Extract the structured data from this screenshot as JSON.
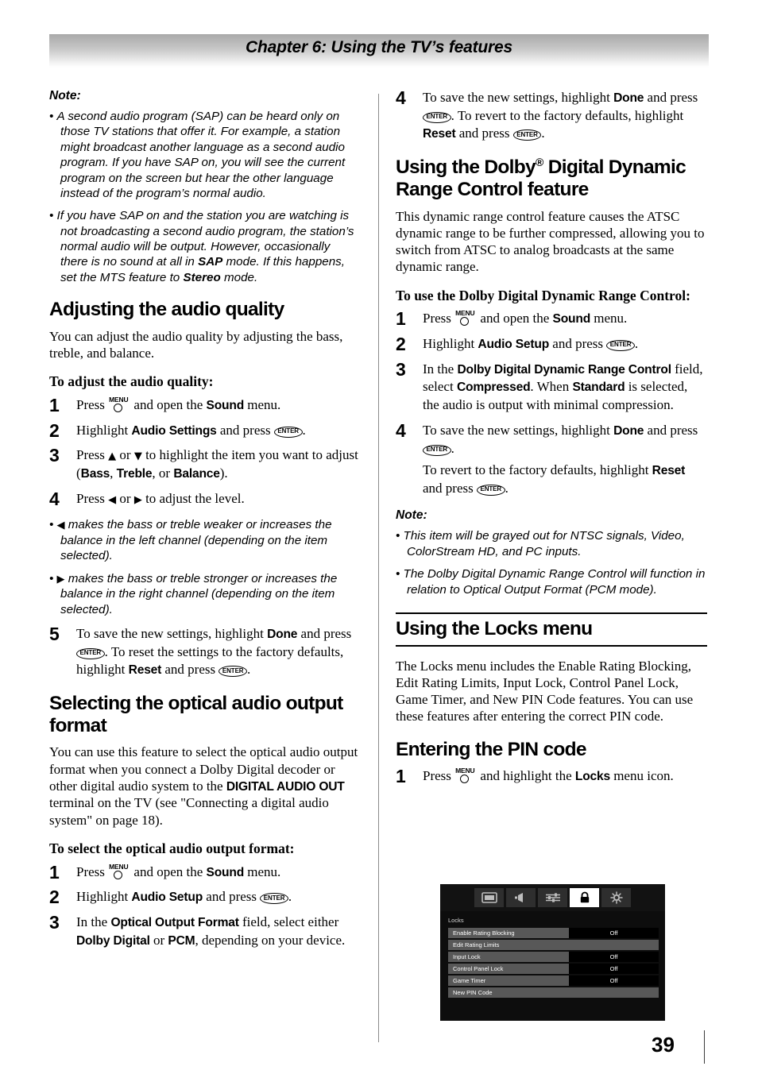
{
  "header": {
    "chapter_title": "Chapter 6: Using the TV’s features"
  },
  "footer": {
    "page_number": "39"
  },
  "left_column": {
    "note": {
      "label": "Note:",
      "items": [
        "A second audio program (SAP) can be heard only on those TV stations that offer it. For example, a station might broadcast another language as a second audio program. If you have SAP on, you will see the current program on the screen but hear the other language instead of the program’s normal audio.",
        {
          "lead": "If you have SAP on and the station you are watching is not broadcasting a second audio program, the station’s normal audio will be output. However, occasionally there is no sound at all in ",
          "bold1": "SAP",
          "mid": " mode. If this happens, set the MTS feature to ",
          "bold2": "Stereo",
          "tail": " mode."
        }
      ]
    },
    "section_audio_quality": {
      "heading": "Adjusting the audio quality",
      "intro": "You can adjust the audio quality by adjusting the bass, treble, and balance.",
      "subheading": "To adjust the audio quality:",
      "steps": [
        {
          "num": "1",
          "pre": "Press ",
          "icon": "menu-button-icon",
          "mid": " and open the ",
          "bold": "Sound",
          "post": " menu."
        },
        {
          "num": "2",
          "pre": "Highlight ",
          "bold": "Audio Settings",
          "mid": " and press ",
          "icon": "enter-button-icon",
          "post": "."
        },
        {
          "num": "3",
          "pre": "Press ",
          "arrow_up": "▲",
          "mid": " or ",
          "arrow_down": "▼",
          "post": " to highlight the item you want to adjust (",
          "bold1": "Bass",
          "sep1": ", ",
          "bold2": "Treble",
          "sep2": ", or ",
          "bold3": "Balance",
          "tail": ")."
        },
        {
          "num": "4",
          "pre": "Press ",
          "arrow_left": "◀",
          "mid": " or ",
          "arrow_right": "▶",
          "post": " to adjust the level."
        }
      ],
      "arrow_notes": [
        {
          "glyph": "◀",
          "text": " makes the bass or treble weaker or increases the balance in the left channel (depending on the item selected)."
        },
        {
          "glyph": "▶",
          "text": " makes the bass or treble stronger or increases the balance in the right channel (depending on the item selected)."
        }
      ],
      "step5": {
        "num": "5",
        "p1_pre": "To save the new settings, highlight ",
        "p1_bold": "Done",
        "p1_mid": " and press ",
        "p1_icon": "enter-button-icon",
        "p1_post": ". To reset the settings to the factory defaults, highlight ",
        "p1_bold2": "Reset",
        "p1_mid2": " and press ",
        "p1_icon2": "enter-button-icon",
        "p1_end": "."
      }
    },
    "section_optical_output": {
      "heading": "Selecting the optical audio output format",
      "intro_pre": "You can use this feature to select the optical audio output format when you connect a Dolby Digital decoder or other digital audio system to the ",
      "intro_bold": "DIGITAL AUDIO OUT",
      "intro_post": " terminal on the TV (see \"Connecting a digital audio system\" on page 18).",
      "subheading": "To select the optical audio output format:",
      "steps": [
        {
          "num": "1",
          "pre": "Press ",
          "icon": "menu-button-icon",
          "mid": " and open the ",
          "bold": "Sound",
          "post": " menu."
        },
        {
          "num": "2",
          "pre": "Highlight ",
          "bold": "Audio Setup",
          "mid": " and press ",
          "icon": "enter-button-icon",
          "post": "."
        },
        {
          "num": "3",
          "pre": "In the ",
          "bold": "Optical Output Format",
          "mid": " field, select either ",
          "bold2": "Dolby Digital",
          "mid2": " or ",
          "bold3": "PCM",
          "post": ", depending on your device."
        }
      ]
    }
  },
  "right_column": {
    "step4_top": {
      "num": "4",
      "pre": "To save the new settings, highlight ",
      "bold": "Done",
      "mid": " and press ",
      "icon": "enter-button-icon",
      "post": ". To revert to the factory defaults, highlight ",
      "bold2": "Reset",
      "mid2": " and press ",
      "icon2": "enter-button-icon",
      "end": "."
    },
    "section_drc": {
      "heading_part1": "Using the Dolby",
      "heading_sup": "®",
      "heading_part2": " Digital Dynamic Range Control feature",
      "intro": "This dynamic range control feature causes the ATSC dynamic range to be further compressed, allowing you to switch from ATSC to analog broadcasts at the same dynamic range.",
      "subheading": "To use the Dolby Digital Dynamic Range Control:",
      "steps": [
        {
          "num": "1",
          "pre": "Press ",
          "icon": "menu-button-icon",
          "mid": " and open the ",
          "bold": "Sound",
          "post": " menu."
        },
        {
          "num": "2",
          "pre": "Highlight ",
          "bold": "Audio Setup",
          "mid": " and press ",
          "icon": "enter-button-icon",
          "post": "."
        },
        {
          "num": "3",
          "pre": "In the ",
          "bold": "Dolby Digital Dynamic Range Control",
          "mid": " field, select ",
          "bold2": "Compressed",
          "mid2": ". When ",
          "bold3": "Standard",
          "post": " is selected, the audio is output with minimal compression."
        }
      ],
      "step4": {
        "num": "4",
        "p1_pre": "To save the new settings, highlight ",
        "p1_bold": "Done",
        "p1_mid": " and press ",
        "p1_icon": "enter-button-icon",
        "p1_end": ".",
        "p2_pre": "To revert to the factory defaults, highlight ",
        "p2_bold": "Reset",
        "p2_mid": " and press ",
        "p2_icon": "enter-button-icon",
        "p2_end": "."
      },
      "note": {
        "label": "Note:",
        "items": [
          "This item will be grayed out for NTSC signals, Video, ColorStream HD, and PC inputs.",
          "The Dolby Digital Dynamic Range Control will function in relation to Optical Output Format (PCM mode)."
        ]
      }
    },
    "section_locks": {
      "heading": "Using the Locks menu",
      "intro": "The Locks menu includes the Enable Rating Blocking, Edit Rating Limits, Input Lock, Control Panel Lock, Game Timer, and New PIN Code features. You can use these features after entering the correct PIN code.",
      "subheading": "Entering the PIN code",
      "step1": {
        "num": "1",
        "pre": "Press ",
        "icon": "menu-button-icon",
        "mid": " and highlight the ",
        "bold": "Locks",
        "post": " menu icon."
      }
    }
  },
  "tv_screen": {
    "icon_bar": [
      {
        "name": "picture-icon",
        "selected": false
      },
      {
        "name": "sound-icon",
        "selected": false
      },
      {
        "name": "settings-sliders-icon",
        "selected": false
      },
      {
        "name": "locks-padlock-icon",
        "selected": true
      },
      {
        "name": "setup-gear-icon",
        "selected": false
      }
    ],
    "menu_title": "Locks",
    "rows": [
      {
        "label": "Enable Rating Blocking",
        "value": "Off"
      },
      {
        "label": "Edit Rating Limits",
        "value": ""
      },
      {
        "label": "Input Lock",
        "value": "Off"
      },
      {
        "label": "Control Panel Lock",
        "value": "Off"
      },
      {
        "label": "Game Timer",
        "value": "Off"
      },
      {
        "label": "New PIN Code",
        "value": ""
      }
    ]
  },
  "colors": {
    "tv_background": "#0d0d0d",
    "tv_icon_tile": "#2e2e2e",
    "tv_icon_selected": "#ffffff",
    "tv_row_label": "#585858",
    "tv_row_value": "#000000",
    "header_gradient_top": "#a9a9a9"
  }
}
